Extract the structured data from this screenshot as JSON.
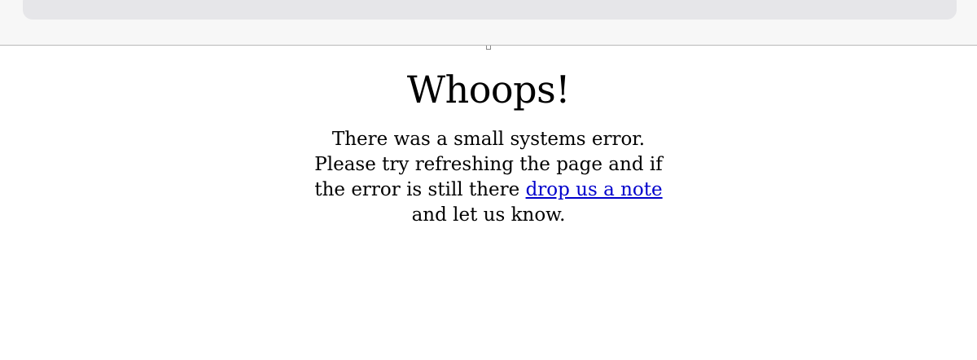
{
  "page": {
    "heading": "Whoops!",
    "message_before_link": "There was a small systems error. Please try refreshing the page and if the error is still there ",
    "link_text": "drop us a note",
    "message_after_link": " and let us know."
  },
  "colors": {
    "link": "#0000cc",
    "address_bar": "#e6e6e9",
    "chrome_background": "#f7f7f7"
  },
  "icons": {
    "reload": "reload-icon",
    "broken_image": "broken-image-icon"
  }
}
